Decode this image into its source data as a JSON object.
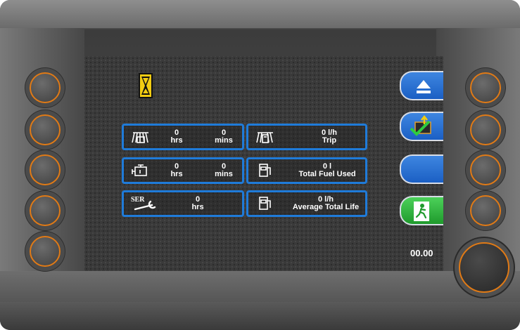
{
  "colors": {
    "accent_blue": "#1f7bd9",
    "button_ring": "#e07a16",
    "softkey_green": "#2db53a",
    "hourglass_yellow": "#f2cc12"
  },
  "status": {
    "hourglass_icon": "hourglass-icon"
  },
  "tiles": {
    "harvest_time": {
      "icon": "harvester-icon",
      "hours_value": "0",
      "hours_unit": "hrs",
      "mins_value": "0",
      "mins_unit": "mins"
    },
    "engine_time": {
      "icon": "engine-icon",
      "hours_value": "0",
      "hours_unit": "hrs",
      "mins_value": "0",
      "mins_unit": "mins"
    },
    "service": {
      "icon": "service-wrench-icon",
      "icon_text": "SER",
      "value": "0",
      "unit": "hrs"
    },
    "trip_fuel": {
      "icon": "harvester-fuel-icon",
      "value": "0 l/h",
      "label": "Trip"
    },
    "total_fuel": {
      "icon": "fuel-pump-icon",
      "value": "0 l",
      "label": "Total Fuel Used"
    },
    "avg_fuel": {
      "icon": "fuel-pump-icon",
      "value": "0 l/h",
      "label": "Average Total Life"
    }
  },
  "softkeys": [
    "eject-icon",
    "confirm-reset-icon",
    "blank-softkey",
    "exit-icon"
  ],
  "clock": "00.00"
}
